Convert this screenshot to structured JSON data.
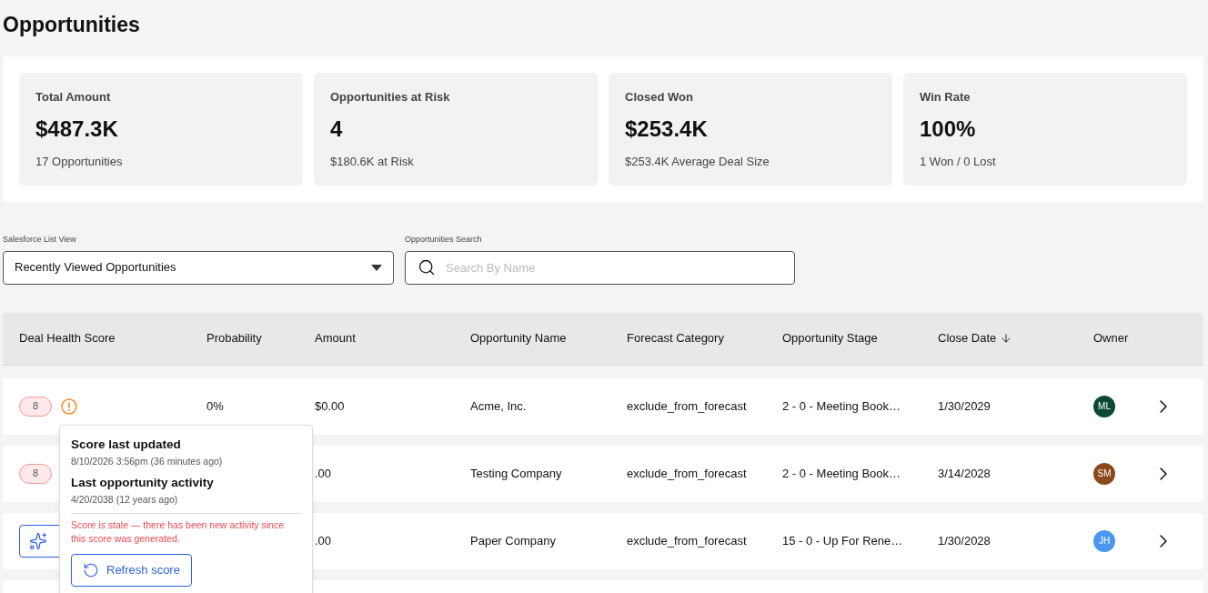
{
  "page": {
    "title": "Opportunities"
  },
  "stats": [
    {
      "label": "Total Amount",
      "value": "$487.3K",
      "sub": "17 Opportunities"
    },
    {
      "label": "Opportunities at Risk",
      "value": "4",
      "sub": "$180.6K at Risk"
    },
    {
      "label": "Closed Won",
      "value": "$253.4K",
      "sub": "$253.4K Average Deal Size"
    },
    {
      "label": "Win Rate",
      "value": "100%",
      "sub": "1 Won / 0 Lost"
    }
  ],
  "filters": {
    "list_view": {
      "label": "Salesforce List View",
      "value": "Recently Viewed Opportunities"
    },
    "search": {
      "label": "Opportunities Search",
      "placeholder": "Search By Name"
    }
  },
  "table": {
    "columns": [
      {
        "label": "Deal Health Score",
        "sorted": false
      },
      {
        "label": "Probability",
        "sorted": false
      },
      {
        "label": "Amount",
        "sorted": false
      },
      {
        "label": "Opportunity Name",
        "sorted": false
      },
      {
        "label": "Forecast Category",
        "sorted": false
      },
      {
        "label": "Opportunity Stage",
        "sorted": false
      },
      {
        "label": "Close Date",
        "sorted": true
      },
      {
        "label": "Owner",
        "sorted": false
      }
    ],
    "rows": [
      {
        "score": {
          "kind": "badge",
          "value": "8",
          "stale": true
        },
        "probability": "0%",
        "amount": "$0.00",
        "name": "Acme, Inc.",
        "forecast": "exclude_from_forecast",
        "stage": "2 - 0 - Meeting Book…",
        "close_date": "1/30/2029",
        "owner": {
          "initials": "ML",
          "color": "#0b4a35"
        }
      },
      {
        "score": {
          "kind": "badge",
          "value": "8",
          "stale": false
        },
        "amount": ".00",
        "name": "Testing Company",
        "forecast": "exclude_from_forecast",
        "stage": "2 - 0 - Meeting Book…",
        "close_date": "3/14/2028",
        "owner": {
          "initials": "SM",
          "color": "#8a4a1e"
        }
      },
      {
        "score": {
          "kind": "generate"
        },
        "amount": ".00",
        "name": "Paper Company",
        "forecast": "exclude_from_forecast",
        "stage": "15 - 0 - Up For Rene…",
        "close_date": "1/30/2028",
        "owner": {
          "initials": "JH",
          "color": "#4a97f0"
        }
      }
    ]
  },
  "popover": {
    "sections": [
      {
        "heading": "Score last updated",
        "detail": "8/10/2026 3:56pm (36 minutes ago)"
      },
      {
        "heading": "Last opportunity activity",
        "detail": "4/20/2038 (12 years ago)"
      }
    ],
    "warning": "Score is stale — there has been new activity since this score was generated.",
    "button": "Refresh score"
  }
}
